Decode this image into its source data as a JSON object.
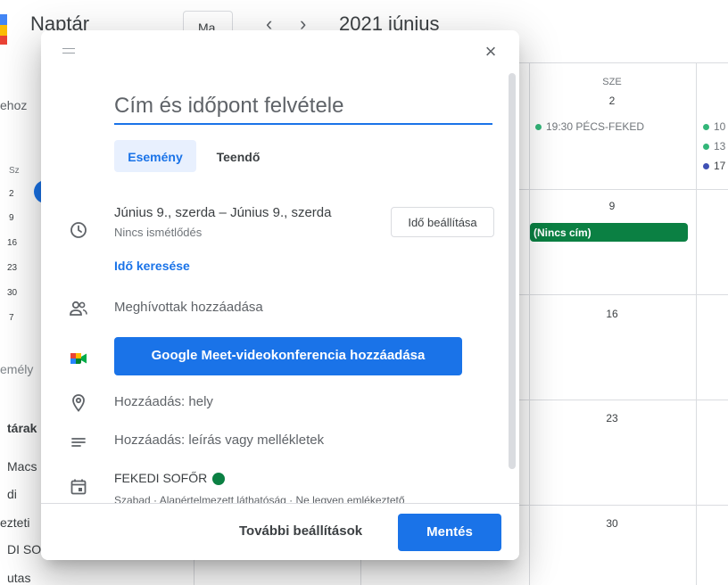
{
  "header": {
    "app_title": "Naptár",
    "today_button": "Ma",
    "prev_arrow": "‹",
    "next_arrow": "›",
    "month_title": "2021 június"
  },
  "sidebar": {
    "create_button_fragment": "ehoz",
    "mini_calendar": {
      "weekday": "Sz",
      "days": [
        "2",
        "9",
        "16",
        "23",
        "30",
        "7"
      ]
    },
    "search_people_fragment": "emély",
    "section_title_fragment": "tárak",
    "calendar_items": [
      "Macs",
      "di",
      "ezteti",
      "DI SO",
      "utas"
    ]
  },
  "calendar": {
    "day_header": "SZE",
    "dates": [
      "2",
      "9",
      "16",
      "23",
      "30"
    ],
    "events": {
      "col_main": "19:30 PÉCS-FEKED",
      "col_right": [
        "10",
        "13",
        "17"
      ],
      "no_title_chip": "(Nincs cím)"
    },
    "colors": {
      "event_green_dot": "#33b679",
      "event_blue_dot": "#3f51b5",
      "chip": "#0b8043"
    }
  },
  "dialog": {
    "close_icon": "×",
    "title_placeholder": "Cím és időpont felvétele",
    "tabs": [
      {
        "label": "Esemény",
        "selected": true
      },
      {
        "label": "Teendő",
        "selected": false
      }
    ],
    "date_range": "Június 9., szerda  –  Június 9., szerda",
    "repeat": "Nincs ismétlődés",
    "time_button": "Idő beállítása",
    "find_time": "Idő keresése",
    "guests": "Meghívottak hozzáadása",
    "meet_button": "Google Meet-videokonferencia hozzáadása",
    "location": "Hozzáadás: hely",
    "description": "Hozzáadás: leírás vagy mellékletek",
    "calendar_name": "FEKEDI SOFŐR",
    "calendar_details": "Szabad · Alapértelmezett láthatóság · Ne legyen emlékeztető",
    "more_options": "További beállítások",
    "save": "Mentés",
    "accent": "#1a73e8"
  }
}
